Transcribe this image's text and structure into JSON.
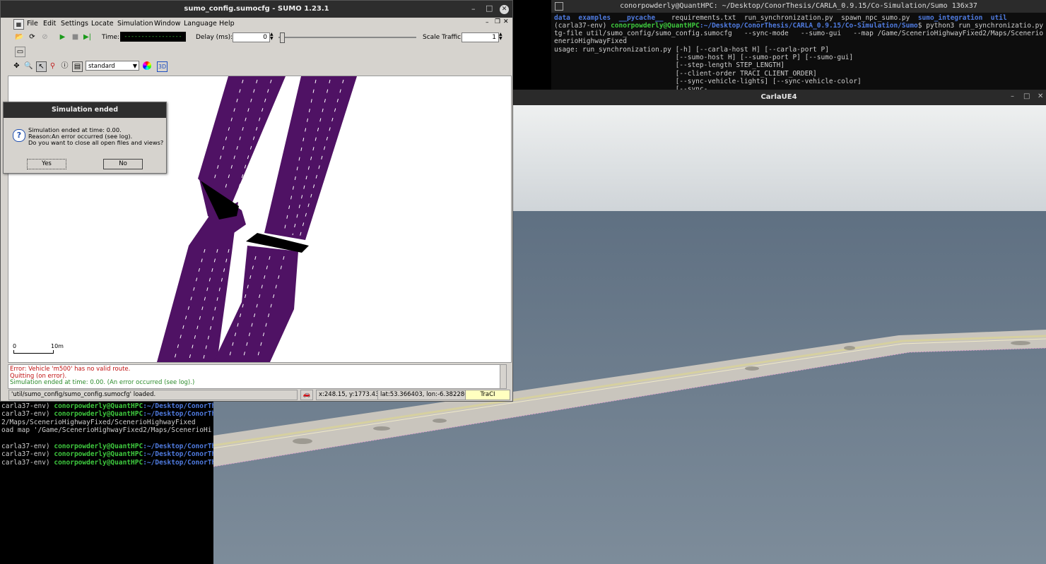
{
  "left_terminal": {
    "edge_chars": [
      "c",
      "",
      "",
      "",
      "",
      "",
      "",
      "",
      "e",
      "",
      "",
      "",
      "",
      "",
      "",
      "",
      "",
      "",
      "",
      "",
      "",
      "",
      "",
      "",
      "",
      "",
      "",
      "",
      "",
      "",
      "",
      "",
      "",
      "",
      "",
      "",
      "",
      "",
      "",
      "",
      "",
      "",
      "",
      "",
      "",
      "",
      "",
      "",
      "",
      "",
      "",
      "",
      "",
      "",
      ""
    ],
    "lines": [
      {
        "prefix": "carla37-env) ",
        "user": "conorpowderly@QuantHPC",
        "path": ":~/Desktop/ConorTh"
      },
      {
        "prefix": "carla37-env) ",
        "user": "conorpowderly@QuantHPC",
        "path": ":~/Desktop/ConorTh"
      },
      {
        "text": "2/Maps/ScenerioHighwayFixed/ScenerioHighwayFixed"
      },
      {
        "text": "oad map '/Game/ScenerioHighwayFixed2/Maps/ScenerioHi"
      },
      {
        "text": ""
      },
      {
        "prefix": "carla37-env) ",
        "user": "conorpowderly@QuantHPC",
        "path": ":~/Desktop/ConorTh"
      },
      {
        "prefix": "carla37-env) ",
        "user": "conorpowderly@QuantHPC",
        "path": ":~/Desktop/ConorTh"
      },
      {
        "prefix": "carla37-env) ",
        "user": "conorpowderly@QuantHPC",
        "path": ":~/Desktop/ConorTh"
      }
    ]
  },
  "right_terminal": {
    "title": "conorpowderly@QuantHPC: ~/Desktop/ConorThesis/CARLA_0.9.15/Co-Simulation/Sumo 136x37",
    "ls_line": [
      {
        "t": "data",
        "c": "blue"
      },
      {
        "t": "  "
      },
      {
        "t": "examples",
        "c": "blue"
      },
      {
        "t": "  "
      },
      {
        "t": "__pycache__",
        "c": "blue"
      },
      {
        "t": "  requirements.txt  run_synchronization.py  spawn_npc_sumo.py  "
      },
      {
        "t": "sumo_integration",
        "c": "blue"
      },
      {
        "t": "  "
      },
      {
        "t": "util",
        "c": "blue"
      }
    ],
    "prompt_env": "(carla37-env) ",
    "prompt_user": "conorpowderly@QuantHPC",
    "prompt_path": ":~/Desktop/ConorThesis/CARLA_0.9.15/Co-Simulation/Sumo",
    "prompt_cmd": "$ python3 run_synchronizatio.py",
    "lines": [
      "tg-file util/sumo_config/sumo_config.sumocfg   --sync-mode   --sumo-gui   --map /Game/ScenerioHighwayFixed2/Maps/Scenerio",
      "enerioHighwayFixed",
      "usage: run_synchronization.py [-h] [--carla-host H] [--carla-port P]",
      "                              [--sumo-host H] [--sumo-port P] [--sumo-gui]",
      "                              [--step-length STEP_LENGTH]",
      "                              [--client-order TRACI_CLIENT_ORDER]",
      "                              [--sync-vehicle-lights] [--sync-vehicle-color]",
      "                              [--sync-..."
    ]
  },
  "carla": {
    "title": "CarlaUE4",
    "sky_color": "#d9dde0",
    "water_color": "#6f7f8f",
    "road_color": "#c9c5bd"
  },
  "sumo": {
    "title": "sumo_config.sumocfg - SUMO 1.23.1",
    "menu": [
      "File",
      "Edit",
      "Settings",
      "Locate",
      "Simulation",
      "Window",
      "Language",
      "Help"
    ],
    "toolbar": {
      "time_label": "Time:",
      "time_value": "-----------------",
      "delay_label": "Delay (ms):",
      "delay_value": "0",
      "scale_label": "Scale Traffic:",
      "scale_value": "1"
    },
    "scheme": "standard",
    "scale_bar": {
      "zero": "0",
      "label": "10m"
    },
    "road_color": "#4f1264",
    "messages": [
      {
        "text": "Error: Vehicle 'm500' has no valid route.",
        "color": "#c01010"
      },
      {
        "text": "Quitting (on error).",
        "color": "#c01010"
      },
      {
        "text": "Simulation ended at time: 0.00. (An error occurred (see log).)",
        "color": "#2a8a2a"
      }
    ],
    "status": {
      "loaded": "'util/sumo_config/sumo_config.sumocfg' loaded.",
      "coords": "x:248.15, y:1773.43",
      "latlon": "lat:53.366403, lon:-6.382286",
      "traci": "TraCI"
    }
  },
  "dialog": {
    "title": "Simulation ended",
    "line1": "Simulation ended at time: 0.00.",
    "line2": "Reason:An error occurred (see log).",
    "line3": "Do you want to close all open files and views?",
    "yes": "Yes",
    "no": "No"
  }
}
